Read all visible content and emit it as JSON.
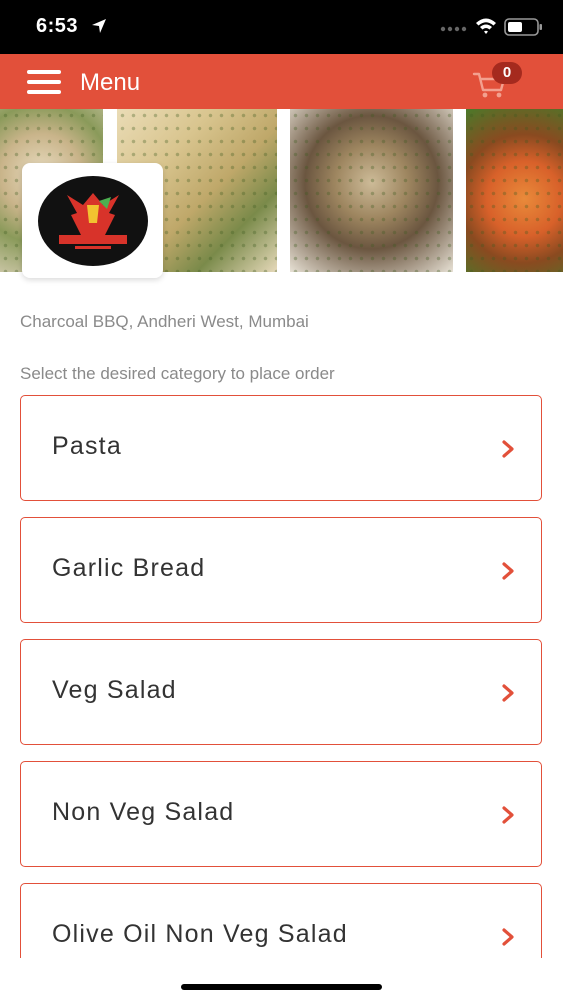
{
  "status_bar": {
    "time": "6:53"
  },
  "header": {
    "title": "Menu",
    "cart_count": "0"
  },
  "restaurant": {
    "location": "Charcoal BBQ, Andheri West, Mumbai"
  },
  "prompt": "Select the desired category to place order",
  "categories": [
    {
      "label": "Pasta"
    },
    {
      "label": "Garlic Bread"
    },
    {
      "label": "Veg Salad"
    },
    {
      "label": "Non Veg Salad"
    },
    {
      "label": "Olive Oil Non Veg Salad"
    }
  ],
  "colors": {
    "accent": "#e2503a",
    "badge": "#a52a1e",
    "muted_text": "#8a8a8a"
  },
  "icons": [
    "location-arrow-icon",
    "signal-icon",
    "wifi-icon",
    "battery-icon",
    "hamburger-icon",
    "cart-icon",
    "chevron-right-icon",
    "restaurant-logo"
  ]
}
